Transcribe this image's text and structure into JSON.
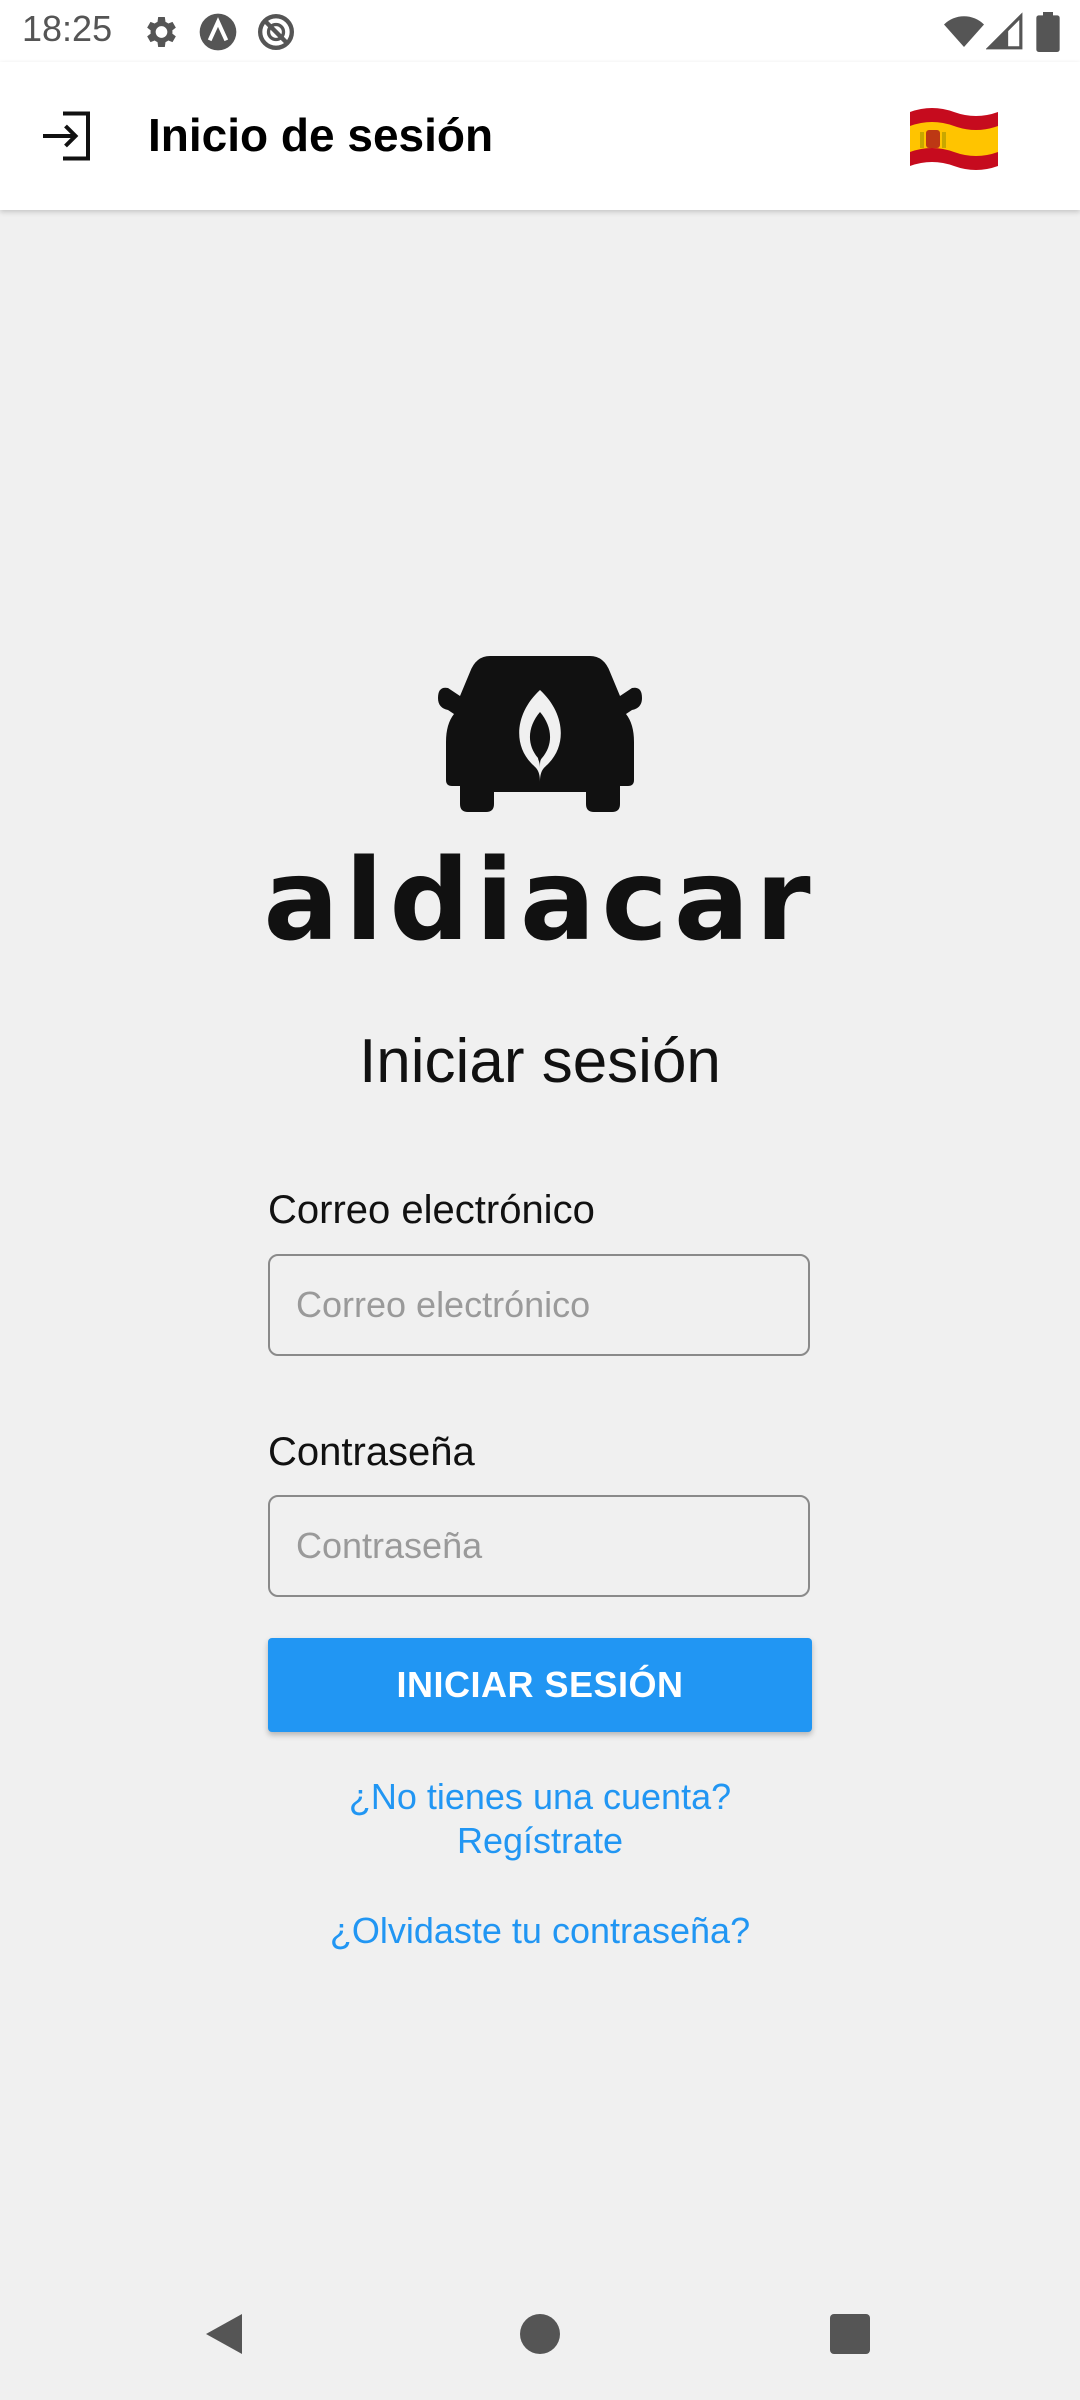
{
  "status_bar": {
    "time": "18:25",
    "icons_left": [
      "gear-icon",
      "a-circle-icon",
      "no-sync-icon"
    ],
    "icons_right": [
      "wifi-icon",
      "signal-icon",
      "battery-icon"
    ]
  },
  "app_bar": {
    "icon": "login-icon",
    "title": "Inicio de sesión",
    "flag": "spain-flag"
  },
  "logo": {
    "text": "aldiacar",
    "icon": "car-leaf-icon"
  },
  "heading": "Iniciar sesión",
  "form": {
    "email_label": "Correo electrónico",
    "email_placeholder": "Correo electrónico",
    "email_value": "",
    "password_label": "Contraseña",
    "password_placeholder": "Contraseña",
    "password_value": "",
    "submit_label": "INICIAR SESIÓN"
  },
  "links": {
    "register_line1": "¿No tienes una cuenta?",
    "register_line2": "Regístrate",
    "forgot": "¿Olvidaste tu contraseña?"
  },
  "colors": {
    "accent": "#2196f3",
    "background": "#f0f0f0",
    "appbar": "#ffffff"
  }
}
